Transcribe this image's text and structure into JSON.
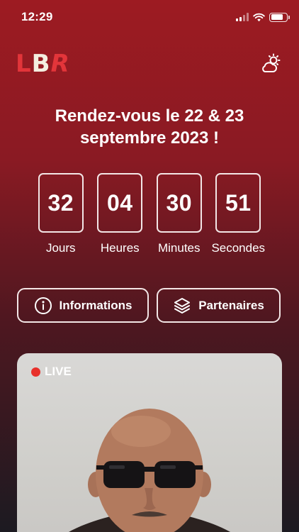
{
  "status_bar": {
    "time": "12:29",
    "icons": [
      "signal-icon",
      "wifi-icon",
      "battery-icon"
    ]
  },
  "header": {
    "logo_letters": [
      "L",
      "B",
      "R"
    ],
    "weather_icon": "cloud-sun-icon"
  },
  "headline": "Rendez-vous le 22 & 23 septembre 2023 !",
  "countdown": [
    {
      "value": "32",
      "label": "Jours"
    },
    {
      "value": "04",
      "label": "Heures"
    },
    {
      "value": "30",
      "label": "Minutes"
    },
    {
      "value": "51",
      "label": "Secondes"
    }
  ],
  "actions": {
    "info_label": "Informations",
    "info_icon": "info-circle-icon",
    "partners_label": "Partenaires",
    "partners_icon": "layers-icon"
  },
  "live": {
    "badge": "LIVE"
  },
  "colors": {
    "accent": "#e3353a",
    "background_top": "#9d1b22",
    "background_bottom": "#1c1a21",
    "live_dot": "#e8302b"
  }
}
